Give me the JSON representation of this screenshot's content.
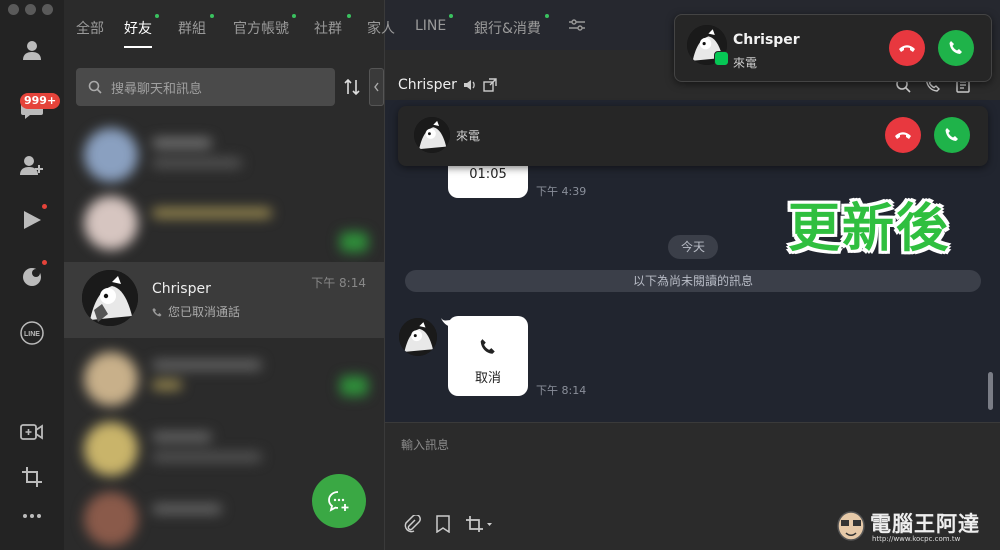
{
  "tabs": [
    {
      "label": "全部",
      "dot": false
    },
    {
      "label": "好友",
      "dot": true,
      "active": true
    },
    {
      "label": "群組",
      "dot": true
    },
    {
      "label": "官方帳號",
      "dot": true
    },
    {
      "label": "社群",
      "dot": true
    },
    {
      "label": "家人",
      "dot": false
    },
    {
      "label": "LINE",
      "dot": true
    },
    {
      "label": "銀行&消費",
      "dot": true
    }
  ],
  "rail": {
    "badge": "999+",
    "line_label": "LINE"
  },
  "search": {
    "placeholder": "搜尋聊天和訊息"
  },
  "friend": {
    "name": "Chrisper",
    "status": "您已取消通話",
    "time": "下午 8:14"
  },
  "chat": {
    "title": "Chrisper",
    "top_duration": "01:05",
    "top_time": "下午 4:39",
    "today": "今天",
    "unread": "以下為尚未閱讀的訊息",
    "cancel_label": "取消",
    "cancel_time": "下午 8:14",
    "composer_placeholder": "輸入訊息"
  },
  "call_big": {
    "name": "Chrisper",
    "subtitle": "來電"
  },
  "call_small": {
    "subtitle": "來電"
  },
  "overlay": "更新後",
  "watermark": {
    "title": "電腦王阿達",
    "url": "http://www.kocpc.com.tw"
  },
  "colors": {
    "accent_green": "#1fb34a",
    "decline_red": "#e8383f",
    "overlay_green": "#2fbf3f"
  }
}
